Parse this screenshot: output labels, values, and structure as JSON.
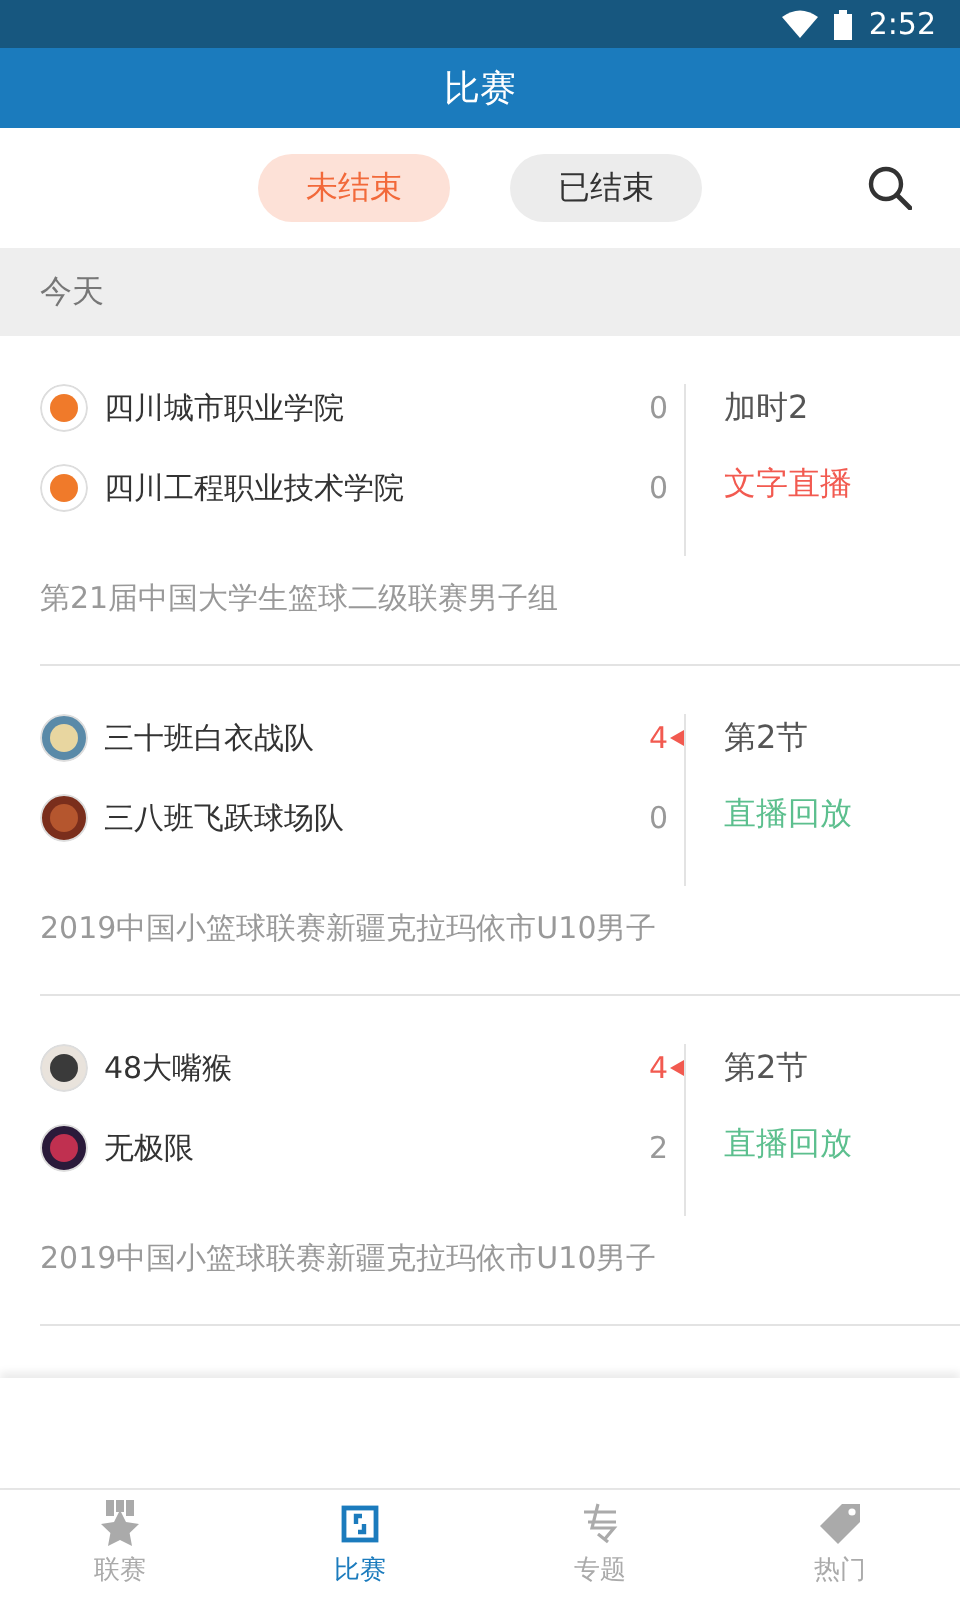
{
  "status_bar": {
    "time": "2:52"
  },
  "header": {
    "title": "比赛"
  },
  "filter_tabs": [
    {
      "label": "未结束",
      "selected": true
    },
    {
      "label": "已结束",
      "selected": false
    }
  ],
  "section": {
    "title": "今天"
  },
  "matches": [
    {
      "teams": [
        {
          "name": "四川城市职业学院",
          "score": "0",
          "leading": false
        },
        {
          "name": "四川工程职业技术学院",
          "score": "0",
          "leading": false
        }
      ],
      "period": "加时2",
      "action": {
        "kind": "text_live",
        "label": "文字直播"
      },
      "league": "第21届中国大学生篮球二级联赛男子组"
    },
    {
      "teams": [
        {
          "name": "三十班白衣战队",
          "score": "4",
          "leading": true
        },
        {
          "name": "三八班飞跃球场队",
          "score": "0",
          "leading": false
        }
      ],
      "period": "第2节",
      "action": {
        "kind": "replay",
        "label": "直播回放"
      },
      "league": "2019中国小篮球联赛新疆克拉玛依市U10男子"
    },
    {
      "teams": [
        {
          "name": "48大嘴猴",
          "score": "4",
          "leading": true
        },
        {
          "name": "无极限",
          "score": "2",
          "leading": false
        }
      ],
      "period": "第2节",
      "action": {
        "kind": "replay",
        "label": "直播回放"
      },
      "league": "2019中国小篮球联赛新疆克拉玛依市U10男子"
    }
  ],
  "bottom_nav": [
    {
      "kind": "league",
      "label": "联赛",
      "selected": false
    },
    {
      "kind": "match",
      "label": "比赛",
      "selected": true
    },
    {
      "kind": "topic",
      "label": "专题",
      "selected": false
    },
    {
      "kind": "hot",
      "label": "热门",
      "selected": false
    }
  ]
}
